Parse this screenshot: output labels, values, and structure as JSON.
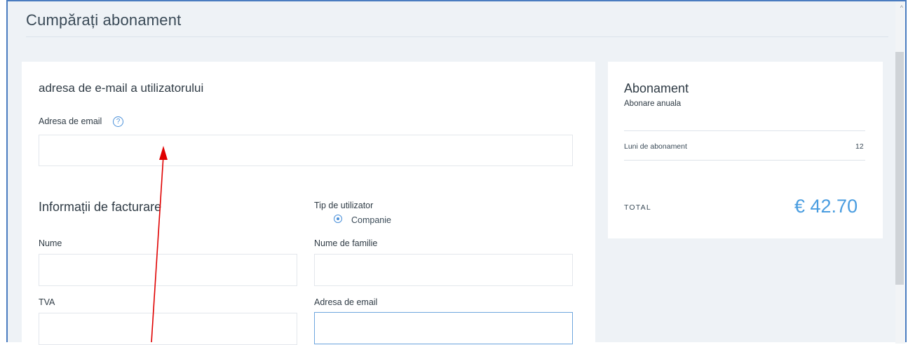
{
  "page": {
    "title": "Cumpărați abonament"
  },
  "email_section": {
    "heading": "adresa de e-mail a utilizatorului",
    "email_label": "Adresa de email",
    "help_glyph": "?"
  },
  "billing": {
    "heading": "Informații de facturare",
    "user_type_label": "Tip de utilizator",
    "user_type_option": "Companie",
    "first_name_label": "Nume",
    "last_name_label": "Nume de familie",
    "vat_label": "TVA",
    "email_label": "Adresa de email"
  },
  "subscription": {
    "heading": "Abonament",
    "plan": "Abonare anuala",
    "months_label": "Luni de abonament",
    "months_value": "12",
    "total_label": "TOTAL",
    "total_value": "€ 42.70"
  },
  "colors": {
    "accent": "#4a9de0",
    "annotation_arrow": "#e00000",
    "frame_border": "#4a7cc0"
  },
  "annotation": {
    "type": "arrow-icon"
  }
}
